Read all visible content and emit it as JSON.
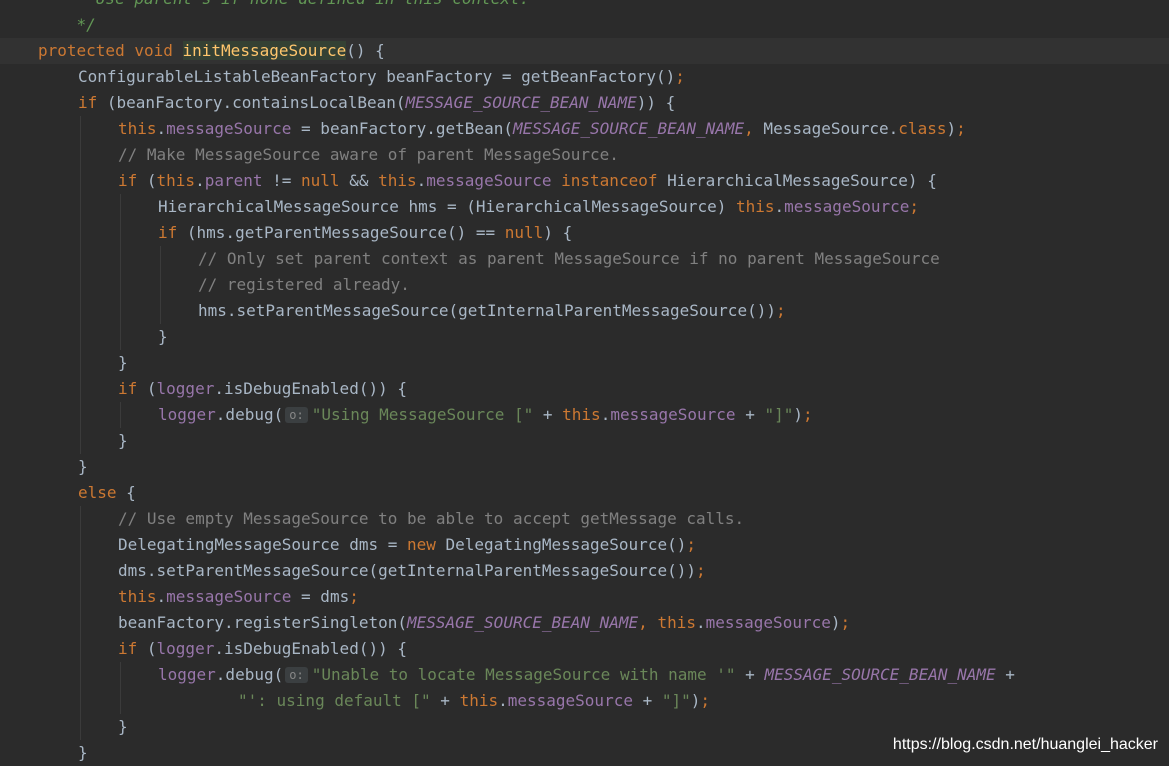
{
  "editor": {
    "lines": [
      {
        "text": "    * Use parent's if none defined in this context."
      },
      {
        "text": "    */"
      },
      {
        "text": "protected void initMessageSource() {"
      },
      {
        "text": "ConfigurableListableBeanFactory beanFactory = getBeanFactory();"
      },
      {
        "text": "if (beanFactory.containsLocalBean(MESSAGE_SOURCE_BEAN_NAME)) {"
      },
      {
        "text": "this.messageSource = beanFactory.getBean(MESSAGE_SOURCE_BEAN_NAME, MessageSource.class);"
      },
      {
        "text": "// Make MessageSource aware of parent MessageSource."
      },
      {
        "text": "if (this.parent != null && this.messageSource instanceof HierarchicalMessageSource) {"
      },
      {
        "text": "HierarchicalMessageSource hms = (HierarchicalMessageSource) this.messageSource;"
      },
      {
        "text": "if (hms.getParentMessageSource() == null) {"
      },
      {
        "text": "// Only set parent context as parent MessageSource if no parent MessageSource"
      },
      {
        "text": "// registered already."
      },
      {
        "text": "hms.setParentMessageSource(getInternalParentMessageSource());"
      },
      {
        "text": "}"
      },
      {
        "text": "}"
      },
      {
        "text": "if (logger.isDebugEnabled()) {"
      },
      {
        "text": "logger.debug( \"Using MessageSource [\" + this.messageSource + \"]\");"
      },
      {
        "text": "}"
      },
      {
        "text": "}"
      },
      {
        "text": "else {"
      },
      {
        "text": "// Use empty MessageSource to be able to accept getMessage calls."
      },
      {
        "text": "DelegatingMessageSource dms = new DelegatingMessageSource();"
      },
      {
        "text": "dms.setParentMessageSource(getInternalParentMessageSource());"
      },
      {
        "text": "this.messageSource = dms;"
      },
      {
        "text": "beanFactory.registerSingleton(MESSAGE_SOURCE_BEAN_NAME, this.messageSource);"
      },
      {
        "text": "if (logger.isDebugEnabled()) {"
      },
      {
        "text": "logger.debug( \"Unable to locate MessageSource with name '\" + MESSAGE_SOURCE_BEAN_NAME +"
      },
      {
        "text": "\"': using default [\" + this.messageSource + \"]\");"
      },
      {
        "text": "}"
      },
      {
        "text": "}"
      }
    ],
    "param_hint": "o:",
    "current_line": 3
  },
  "watermark": "https://blog.csdn.net/huanglei_hacker",
  "colors": {
    "background": "#2b2b2b",
    "keyword": "#cc7832",
    "field": "#9876aa",
    "string": "#6a8759",
    "comment": "#808080",
    "method_declaration": "#ffc66d",
    "default_text": "#a9b7c6"
  }
}
